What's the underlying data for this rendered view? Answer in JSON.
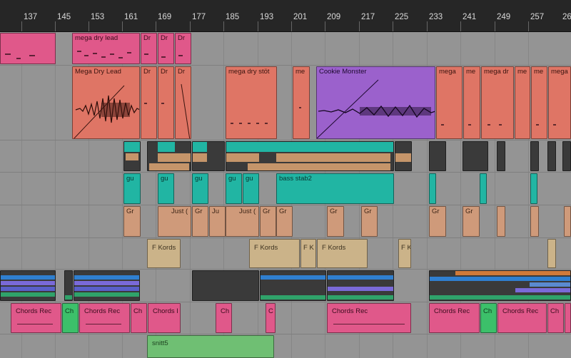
{
  "ruler": {
    "ticks": [
      "137",
      "145",
      "153",
      "161",
      "169",
      "177",
      "185",
      "193",
      "201",
      "209",
      "217",
      "225",
      "233",
      "241",
      "249",
      "257",
      "26"
    ]
  },
  "clips": {
    "mega_dry_lead": "mega dry lead",
    "dr": "Dr",
    "mega_dry_lead_audio": "Mega Dry Lead",
    "mega_dry_stot": "mega dry stöt",
    "me": "me",
    "cookie_monster": "Cookie Monster",
    "mega": "mega",
    "mega_dr": "mega dr",
    "gu": "gu",
    "bass_stab2": "bass stab2",
    "gr": "Gr",
    "just": "Just (",
    "ju": "Ju",
    "f_kords": "F Kords",
    "f_k": "F K",
    "f": "F",
    "chords_rec": "Chords Rec",
    "ch": "Ch",
    "chords_rec_cut": "Chords I",
    "c": "C",
    "snitt5": "snitt5"
  },
  "colors": {
    "pink": "#e0588a",
    "salmon": "#df7565",
    "purple": "#9b61cc",
    "teal": "#21b5a3",
    "tan": "#cf9a7a",
    "beige": "#cbb389",
    "green": "#3cc06a",
    "ruler": "#262626"
  }
}
